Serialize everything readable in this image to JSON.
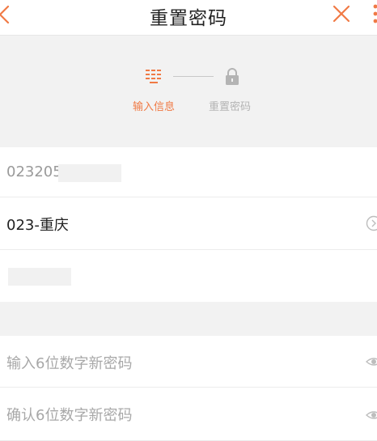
{
  "header": {
    "title": "重置密码",
    "back_icon": "chevron-left-icon",
    "close_icon": "close-icon",
    "more_icon": "more-vertical-icon"
  },
  "steps": {
    "items": [
      {
        "label": "输入信息",
        "icon": "keyboard-icon",
        "state": "active"
      },
      {
        "label": "重置密码",
        "icon": "lock-icon",
        "state": "inactive"
      }
    ]
  },
  "form": {
    "account": {
      "value": "023205",
      "icon": ""
    },
    "region": {
      "value": "023-重庆",
      "icon": "chevron-right-circle-icon"
    },
    "name": {
      "value": ""
    },
    "new_password": {
      "placeholder": "输入6位数字新密码",
      "icon": "eye-icon"
    },
    "confirm_password": {
      "placeholder": "确认6位数字新密码",
      "icon": "eye-icon"
    }
  },
  "colors": {
    "accent": "#f07a45",
    "inactive": "#b4b4b4",
    "background": "#f2f2f2"
  }
}
